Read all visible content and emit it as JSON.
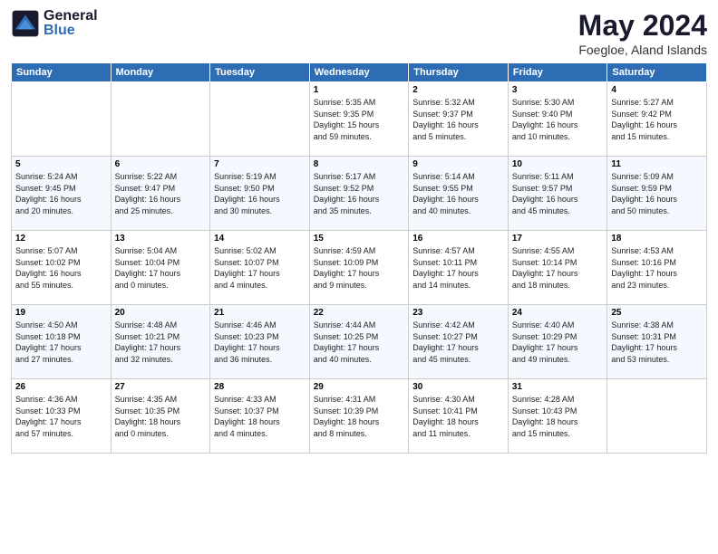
{
  "header": {
    "logo_general": "General",
    "logo_blue": "Blue",
    "month": "May 2024",
    "location": "Foegloe, Aland Islands"
  },
  "weekdays": [
    "Sunday",
    "Monday",
    "Tuesday",
    "Wednesday",
    "Thursday",
    "Friday",
    "Saturday"
  ],
  "weeks": [
    [
      {
        "day": "",
        "info": ""
      },
      {
        "day": "",
        "info": ""
      },
      {
        "day": "",
        "info": ""
      },
      {
        "day": "1",
        "info": "Sunrise: 5:35 AM\nSunset: 9:35 PM\nDaylight: 15 hours\nand 59 minutes."
      },
      {
        "day": "2",
        "info": "Sunrise: 5:32 AM\nSunset: 9:37 PM\nDaylight: 16 hours\nand 5 minutes."
      },
      {
        "day": "3",
        "info": "Sunrise: 5:30 AM\nSunset: 9:40 PM\nDaylight: 16 hours\nand 10 minutes."
      },
      {
        "day": "4",
        "info": "Sunrise: 5:27 AM\nSunset: 9:42 PM\nDaylight: 16 hours\nand 15 minutes."
      }
    ],
    [
      {
        "day": "5",
        "info": "Sunrise: 5:24 AM\nSunset: 9:45 PM\nDaylight: 16 hours\nand 20 minutes."
      },
      {
        "day": "6",
        "info": "Sunrise: 5:22 AM\nSunset: 9:47 PM\nDaylight: 16 hours\nand 25 minutes."
      },
      {
        "day": "7",
        "info": "Sunrise: 5:19 AM\nSunset: 9:50 PM\nDaylight: 16 hours\nand 30 minutes."
      },
      {
        "day": "8",
        "info": "Sunrise: 5:17 AM\nSunset: 9:52 PM\nDaylight: 16 hours\nand 35 minutes."
      },
      {
        "day": "9",
        "info": "Sunrise: 5:14 AM\nSunset: 9:55 PM\nDaylight: 16 hours\nand 40 minutes."
      },
      {
        "day": "10",
        "info": "Sunrise: 5:11 AM\nSunset: 9:57 PM\nDaylight: 16 hours\nand 45 minutes."
      },
      {
        "day": "11",
        "info": "Sunrise: 5:09 AM\nSunset: 9:59 PM\nDaylight: 16 hours\nand 50 minutes."
      }
    ],
    [
      {
        "day": "12",
        "info": "Sunrise: 5:07 AM\nSunset: 10:02 PM\nDaylight: 16 hours\nand 55 minutes."
      },
      {
        "day": "13",
        "info": "Sunrise: 5:04 AM\nSunset: 10:04 PM\nDaylight: 17 hours\nand 0 minutes."
      },
      {
        "day": "14",
        "info": "Sunrise: 5:02 AM\nSunset: 10:07 PM\nDaylight: 17 hours\nand 4 minutes."
      },
      {
        "day": "15",
        "info": "Sunrise: 4:59 AM\nSunset: 10:09 PM\nDaylight: 17 hours\nand 9 minutes."
      },
      {
        "day": "16",
        "info": "Sunrise: 4:57 AM\nSunset: 10:11 PM\nDaylight: 17 hours\nand 14 minutes."
      },
      {
        "day": "17",
        "info": "Sunrise: 4:55 AM\nSunset: 10:14 PM\nDaylight: 17 hours\nand 18 minutes."
      },
      {
        "day": "18",
        "info": "Sunrise: 4:53 AM\nSunset: 10:16 PM\nDaylight: 17 hours\nand 23 minutes."
      }
    ],
    [
      {
        "day": "19",
        "info": "Sunrise: 4:50 AM\nSunset: 10:18 PM\nDaylight: 17 hours\nand 27 minutes."
      },
      {
        "day": "20",
        "info": "Sunrise: 4:48 AM\nSunset: 10:21 PM\nDaylight: 17 hours\nand 32 minutes."
      },
      {
        "day": "21",
        "info": "Sunrise: 4:46 AM\nSunset: 10:23 PM\nDaylight: 17 hours\nand 36 minutes."
      },
      {
        "day": "22",
        "info": "Sunrise: 4:44 AM\nSunset: 10:25 PM\nDaylight: 17 hours\nand 40 minutes."
      },
      {
        "day": "23",
        "info": "Sunrise: 4:42 AM\nSunset: 10:27 PM\nDaylight: 17 hours\nand 45 minutes."
      },
      {
        "day": "24",
        "info": "Sunrise: 4:40 AM\nSunset: 10:29 PM\nDaylight: 17 hours\nand 49 minutes."
      },
      {
        "day": "25",
        "info": "Sunrise: 4:38 AM\nSunset: 10:31 PM\nDaylight: 17 hours\nand 53 minutes."
      }
    ],
    [
      {
        "day": "26",
        "info": "Sunrise: 4:36 AM\nSunset: 10:33 PM\nDaylight: 17 hours\nand 57 minutes."
      },
      {
        "day": "27",
        "info": "Sunrise: 4:35 AM\nSunset: 10:35 PM\nDaylight: 18 hours\nand 0 minutes."
      },
      {
        "day": "28",
        "info": "Sunrise: 4:33 AM\nSunset: 10:37 PM\nDaylight: 18 hours\nand 4 minutes."
      },
      {
        "day": "29",
        "info": "Sunrise: 4:31 AM\nSunset: 10:39 PM\nDaylight: 18 hours\nand 8 minutes."
      },
      {
        "day": "30",
        "info": "Sunrise: 4:30 AM\nSunset: 10:41 PM\nDaylight: 18 hours\nand 11 minutes."
      },
      {
        "day": "31",
        "info": "Sunrise: 4:28 AM\nSunset: 10:43 PM\nDaylight: 18 hours\nand 15 minutes."
      },
      {
        "day": "",
        "info": ""
      }
    ]
  ]
}
